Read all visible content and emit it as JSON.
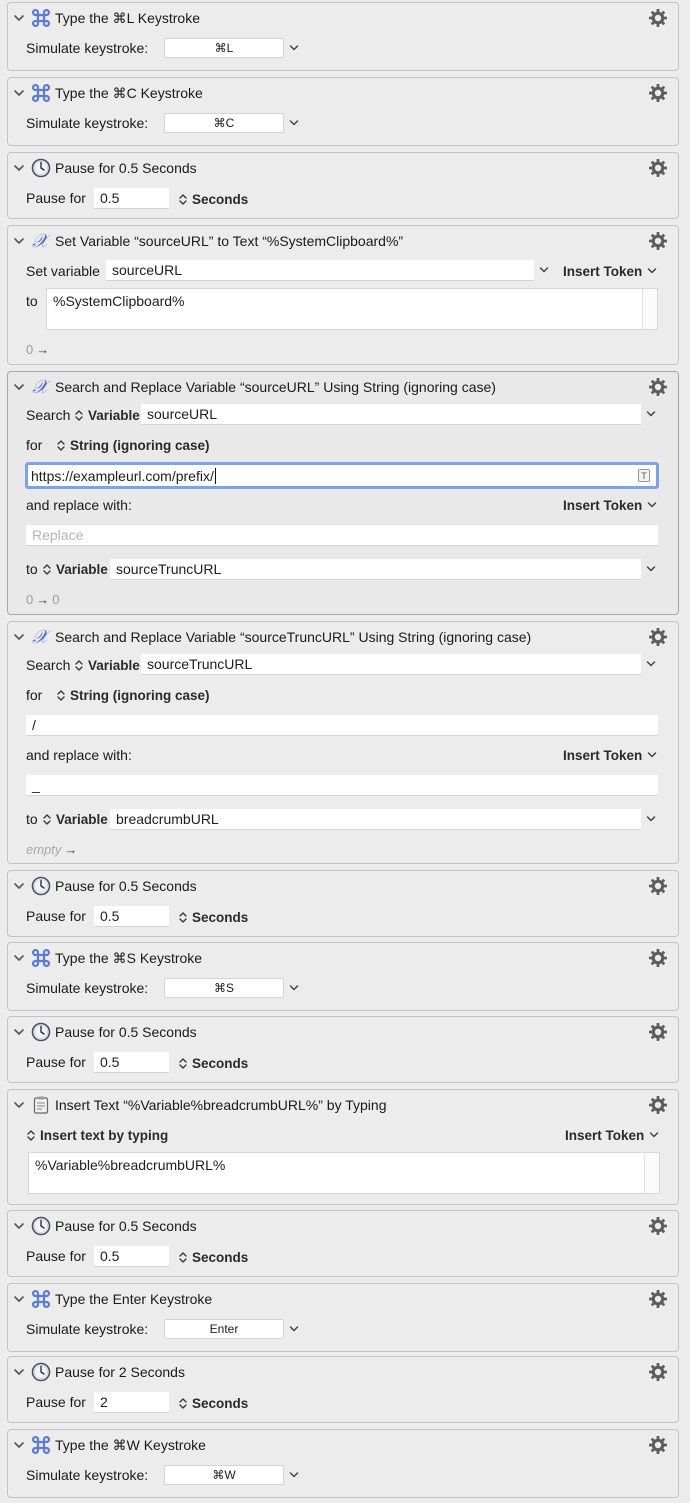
{
  "actions": [
    {
      "title": "Type the ⌘L Keystroke",
      "label": "Simulate keystroke:",
      "key": "⌘L"
    },
    {
      "title": "Type the ⌘C Keystroke",
      "label": "Simulate keystroke:",
      "key": "⌘C"
    },
    {
      "title": "Pause for 0.5 Seconds",
      "label": "Pause for",
      "value": "0.5",
      "unit": "Seconds"
    },
    {
      "title": "Set Variable “sourceURL” to Text “%SystemClipboard%”",
      "label": "Set variable",
      "variable": "sourceURL",
      "token": "Insert Token",
      "to_label": "to",
      "text": "%SystemClipboard%",
      "count": "0",
      "arrow": "→"
    },
    {
      "title": "Search and Replace Variable “sourceURL” Using String (ignoring case)",
      "search_label": "Search",
      "search_type": "Variable",
      "search_var": "sourceURL",
      "for_label": "for",
      "for_type": "String (ignoring case)",
      "search_text": "https://exampleurl.com/prefix/",
      "badge": "T",
      "replace_label": "and replace with:",
      "token": "Insert Token",
      "replace_placeholder": "Replace",
      "to_label": "to",
      "to_type": "Variable",
      "to_var": "sourceTruncURL",
      "count_a": "0",
      "arrow": "→",
      "count_b": "0"
    },
    {
      "title": "Search and Replace Variable “sourceTruncURL” Using String (ignoring case)",
      "search_label": "Search",
      "search_type": "Variable",
      "search_var": "sourceTruncURL",
      "for_label": "for",
      "for_type": "String (ignoring case)",
      "search_text": "/",
      "replace_label": "and replace with:",
      "token": "Insert Token",
      "replace_text": "_",
      "to_label": "to",
      "to_type": "Variable",
      "to_var": "breadcrumbURL",
      "count": "empty",
      "arrow": "→"
    },
    {
      "title": "Pause for 0.5 Seconds",
      "label": "Pause for",
      "value": "0.5",
      "unit": "Seconds"
    },
    {
      "title": "Type the ⌘S Keystroke",
      "label": "Simulate keystroke:",
      "key": "⌘S"
    },
    {
      "title": "Pause for 0.5 Seconds",
      "label": "Pause for",
      "value": "0.5",
      "unit": "Seconds"
    },
    {
      "title": "Insert Text “%Variable%breadcrumbURL%” by Typing",
      "mode": "Insert text by typing",
      "token": "Insert Token",
      "text": "%Variable%breadcrumbURL%"
    },
    {
      "title": "Pause for 0.5 Seconds",
      "label": "Pause for",
      "value": "0.5",
      "unit": "Seconds"
    },
    {
      "title": "Type the Enter Keystroke",
      "label": "Simulate keystroke:",
      "key": "Enter"
    },
    {
      "title": "Pause for 2 Seconds",
      "label": "Pause for",
      "value": "2",
      "unit": "Seconds"
    },
    {
      "title": "Type the ⌘W Keystroke",
      "label": "Simulate keystroke:",
      "key": "⌘W"
    }
  ],
  "icons": {
    "keystroke": "command-icon",
    "pause": "clock-icon",
    "variable": "variable-x-icon",
    "insert": "clipboard-icon",
    "settings": "gear-icon"
  },
  "colors": {
    "background": "#ececec",
    "focus": "#7aa4e6",
    "variable_icon": "#4b6fd6",
    "command_icon": "#5a7bd8"
  }
}
